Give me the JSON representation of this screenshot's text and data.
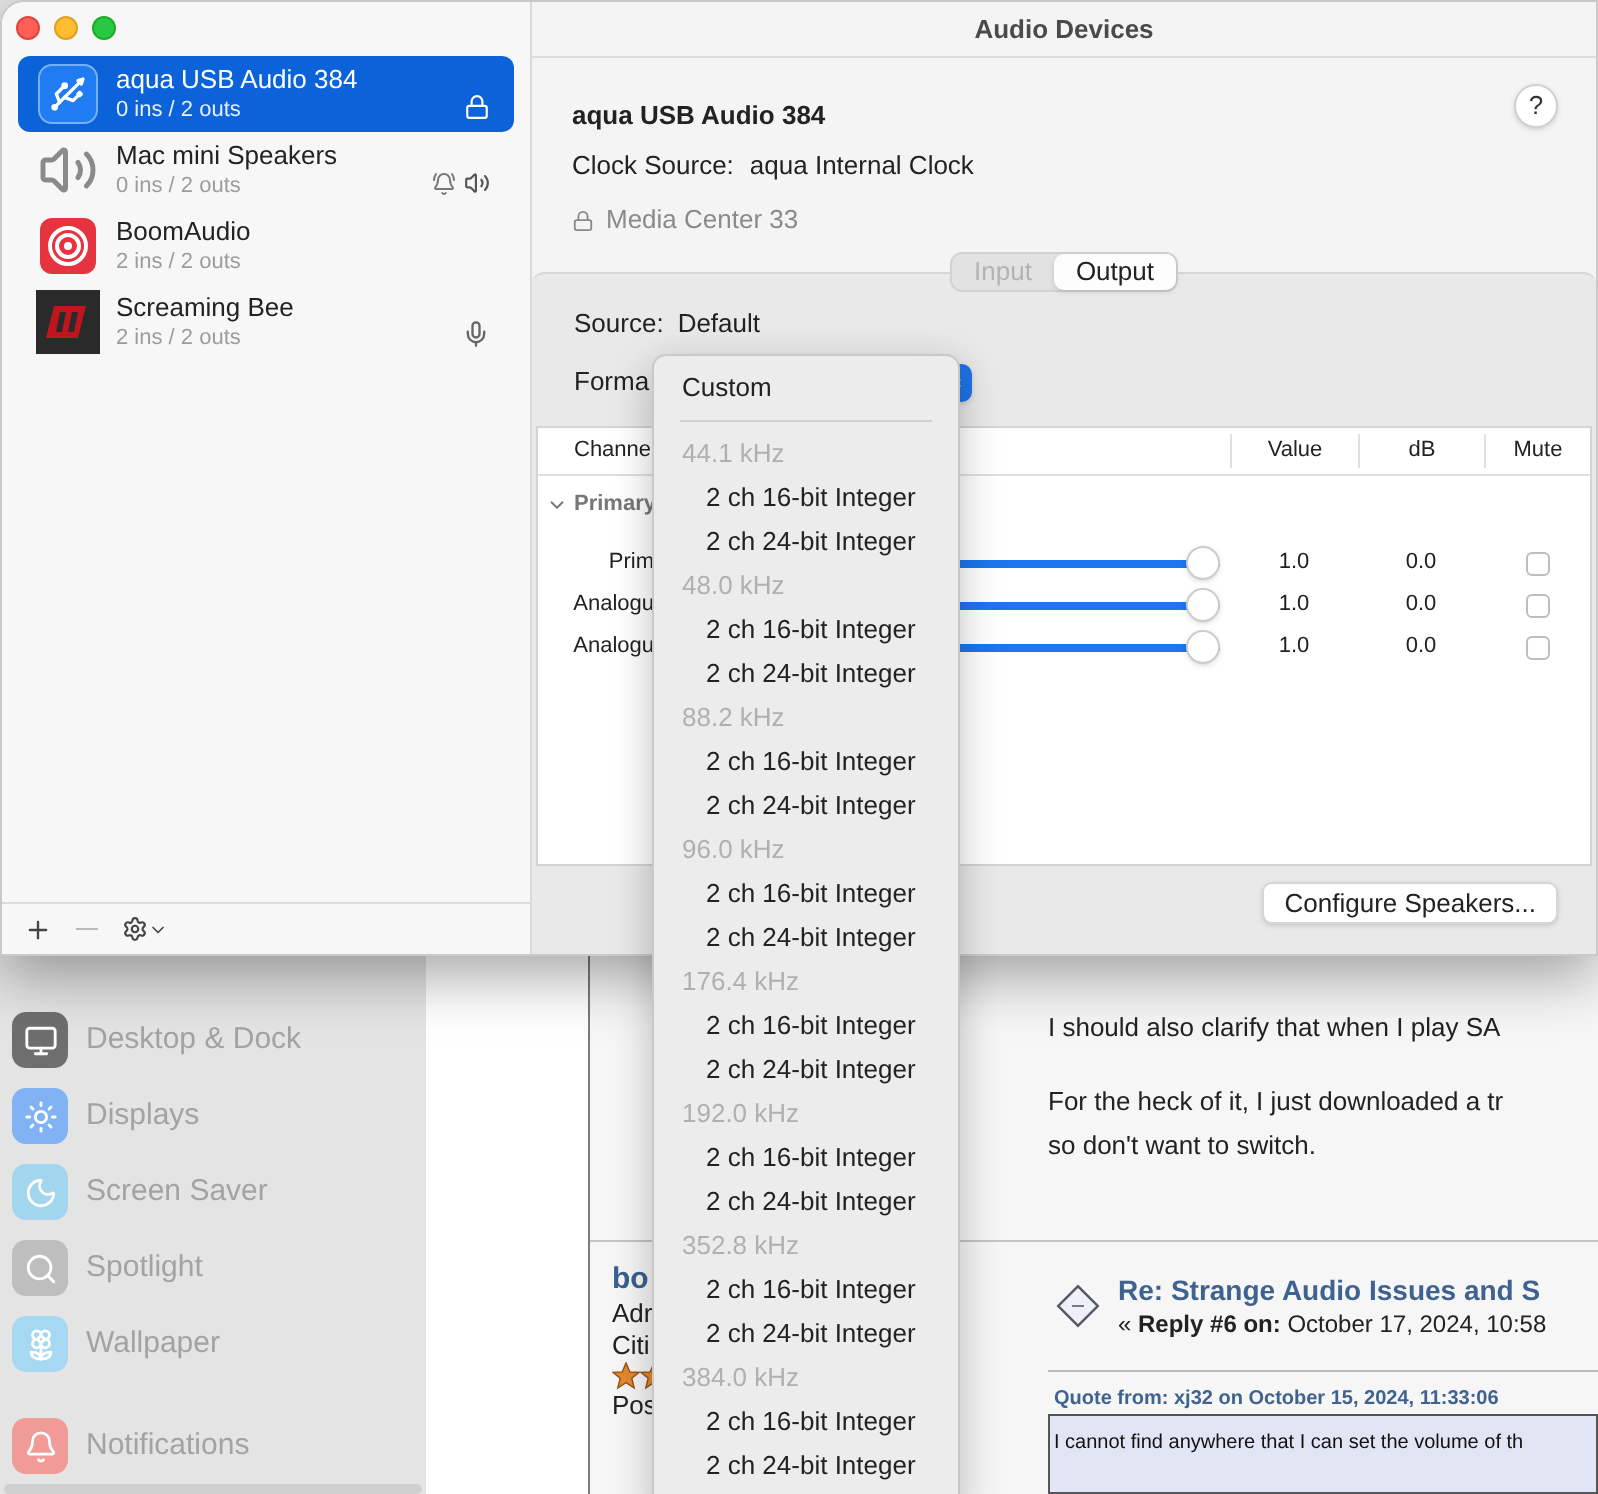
{
  "window": {
    "title": "Audio Devices"
  },
  "devices": [
    {
      "name": "aqua USB Audio 384",
      "io": "0 ins / 2 outs",
      "kind": "usb",
      "selected": true,
      "locked": true,
      "alert_output": false,
      "default_output": false,
      "default_input": false
    },
    {
      "name": "Mac mini Speakers",
      "io": "0 ins / 2 outs",
      "kind": "speaker",
      "selected": false,
      "locked": false,
      "alert_output": true,
      "default_output": true,
      "default_input": false
    },
    {
      "name": "BoomAudio",
      "io": "2 ins / 2 outs",
      "kind": "target",
      "selected": false,
      "locked": false,
      "alert_output": false,
      "default_output": false,
      "default_input": false
    },
    {
      "name": "Screaming Bee",
      "io": "2 ins / 2 outs",
      "kind": "logo",
      "selected": false,
      "locked": false,
      "alert_output": false,
      "default_output": false,
      "default_input": true
    }
  ],
  "detail": {
    "device_name": "aqua USB Audio 384",
    "clock_source_label": "Clock Source:",
    "clock_source": "aqua Internal Clock",
    "owner": "Media Center 33",
    "help": "?"
  },
  "tabs": [
    {
      "label": "Input",
      "selected": false,
      "disabled": true
    },
    {
      "label": "Output",
      "selected": true,
      "disabled": false
    }
  ],
  "source_label": "Source:",
  "source": "Default",
  "format_label": "Forma",
  "table": {
    "columns": [
      "Channe",
      "Value",
      "dB",
      "Mute"
    ],
    "group": {
      "label": "Primary",
      "expanded": true
    },
    "rows": [
      {
        "name": "Prim",
        "level": 1,
        "value": "1.0",
        "db": "0.0",
        "muted": false
      },
      {
        "name": "Analogu",
        "level": 1,
        "value": "1.0",
        "db": "0.0",
        "muted": false
      },
      {
        "name": "Analogu",
        "level": 1,
        "value": "1.0",
        "db": "0.0",
        "muted": false
      }
    ]
  },
  "configure_button": "Configure Speakers...",
  "format_menu": {
    "items": [
      {
        "kind": "option",
        "label": "Custom"
      },
      {
        "kind": "separator"
      },
      {
        "kind": "header",
        "label": "44.1 kHz"
      },
      {
        "kind": "option",
        "label": "2 ch 16-bit Integer"
      },
      {
        "kind": "option",
        "label": "2 ch 24-bit Integer"
      },
      {
        "kind": "header",
        "label": "48.0 kHz"
      },
      {
        "kind": "option",
        "label": "2 ch 16-bit Integer"
      },
      {
        "kind": "option",
        "label": "2 ch 24-bit Integer"
      },
      {
        "kind": "header",
        "label": "88.2 kHz"
      },
      {
        "kind": "option",
        "label": "2 ch 16-bit Integer"
      },
      {
        "kind": "option",
        "label": "2 ch 24-bit Integer"
      },
      {
        "kind": "header",
        "label": "96.0 kHz"
      },
      {
        "kind": "option",
        "label": "2 ch 16-bit Integer"
      },
      {
        "kind": "option",
        "label": "2 ch 24-bit Integer"
      },
      {
        "kind": "header",
        "label": "176.4 kHz"
      },
      {
        "kind": "option",
        "label": "2 ch 16-bit Integer"
      },
      {
        "kind": "option",
        "label": "2 ch 24-bit Integer"
      },
      {
        "kind": "header",
        "label": "192.0 kHz"
      },
      {
        "kind": "option",
        "label": "2 ch 16-bit Integer"
      },
      {
        "kind": "option",
        "label": "2 ch 24-bit Integer"
      },
      {
        "kind": "header",
        "label": "352.8 kHz"
      },
      {
        "kind": "option",
        "label": "2 ch 16-bit Integer"
      },
      {
        "kind": "option",
        "label": "2 ch 24-bit Integer"
      },
      {
        "kind": "header",
        "label": "384.0 kHz"
      },
      {
        "kind": "option",
        "label": "2 ch 16-bit Integer"
      },
      {
        "kind": "option",
        "label": "2 ch 24-bit Integer"
      }
    ]
  },
  "settings_sidebar": [
    {
      "label": "Desktop & Dock",
      "color": "#6e6e6e"
    },
    {
      "label": "Displays",
      "color": "#80b2f4"
    },
    {
      "label": "Screen Saver",
      "color": "#a2d6ef"
    },
    {
      "label": "Spotlight",
      "color": "#bebebe"
    },
    {
      "label": "Wallpaper",
      "color": "#a6d9f1"
    },
    {
      "label": "Notifications",
      "color": "#f19b97"
    }
  ],
  "post": {
    "paragraphs": [
      {
        "lines": [
          "I should also clarify that when I play SA"
        ]
      },
      {
        "lines": [
          "For the heck of it, I just downloaded a tr",
          "so don't want to switch."
        ]
      }
    ],
    "author": {
      "name": "bo",
      "lines": [
        "Adr",
        "Citi"
      ],
      "posts": "Pos"
    },
    "reply": {
      "title": "Re: Strange Audio Issues and S",
      "meta": "« **Reply #6 on:** October 17, 2024, 10:58"
    },
    "quote": {
      "header": "Quote from: xj32 on October 15, 2024, 11:33:06",
      "text": "I cannot find anywhere that I can set the volume of th"
    }
  }
}
